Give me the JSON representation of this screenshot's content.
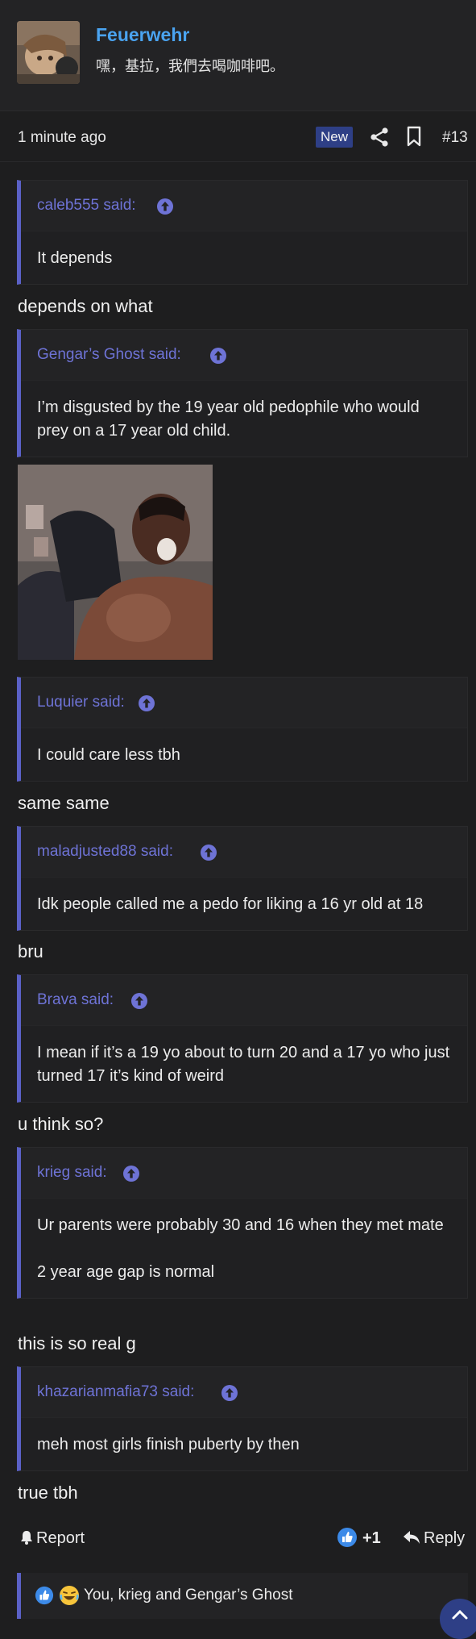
{
  "user": {
    "name": "Feuerwehr",
    "title": "嘿，基拉，我們去喝咖啡吧。"
  },
  "meta": {
    "time": "1 minute ago",
    "badge": "New",
    "post_number": "#13"
  },
  "quotes": [
    {
      "author": "caleb555 said:",
      "body": [
        "It depends"
      ]
    },
    {
      "author": "Gengar’s Ghost said:",
      "body": [
        "I’m disgusted by the 19 year old pedophile who would prey on a 17 year old child."
      ]
    },
    {
      "author": "Luquier said:",
      "body": [
        "I could care less tbh"
      ]
    },
    {
      "author": "maladjusted88 said:",
      "body": [
        "Idk people called me a pedo for liking a 16 yr old at 18"
      ]
    },
    {
      "author": "Brava said:",
      "body": [
        "I mean if it’s a 19 yo about to turn 20 and a 17 yo who just turned 17 it’s kind of weird"
      ]
    },
    {
      "author": "krieg said:",
      "body": [
        "Ur parents were probably 30 and 16 when they met mate",
        "2 year age gap is normal"
      ]
    },
    {
      "author": "khazarianmafia73 said:",
      "body": [
        "meh most girls finish puberty by then"
      ]
    }
  ],
  "replies": [
    "depends on what",
    "same same",
    "bru",
    "u think so?",
    "this is so real g",
    "true tbh"
  ],
  "footer": {
    "report": "Report",
    "like_count": "+1",
    "reply": "Reply"
  },
  "reactions": {
    "text": "You, krieg and Gengar’s Ghost"
  },
  "colors": {
    "accent": "#5b61c7",
    "username": "#4aa3f0",
    "badge": "#2e3f86"
  }
}
